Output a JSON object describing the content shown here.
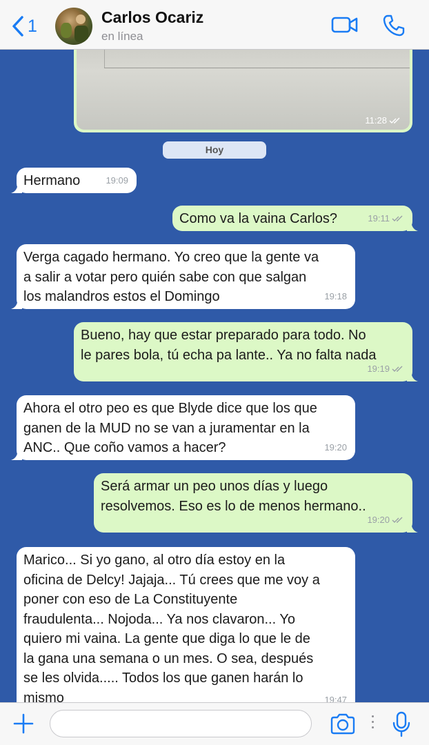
{
  "header": {
    "back_count": "1",
    "contact_name": "Carlos Ocariz",
    "status": "en línea",
    "back_icon": "chevron-left-icon",
    "video_icon": "video-call-icon",
    "phone_icon": "phone-icon"
  },
  "chat": {
    "image_message": {
      "time": "11:28"
    },
    "date_separator": "Hoy",
    "messages": [
      {
        "direction": "in",
        "text": "Hermano",
        "time": "19:09"
      },
      {
        "direction": "out",
        "text": "Como va la vaina Carlos?",
        "time": "19:11"
      },
      {
        "direction": "in",
        "text": "Verga cagado hermano. Yo creo que la gente va\na salir a votar pero quién sabe con que salgan\nlos malandros estos el Domingo",
        "time": "19:18"
      },
      {
        "direction": "out",
        "text": "Bueno, hay que estar preparado para todo. No\nle pares bola, tú echa pa lante.. Ya no falta nada",
        "time": "19:19"
      },
      {
        "direction": "in",
        "text": "Ahora el otro peo es que Blyde dice que los que\nganen de la MUD no se van a juramentar en la\nANC.. Que coño vamos a hacer?",
        "time": "19:20"
      },
      {
        "direction": "out",
        "text": "Será armar un peo unos días y luego\nresolvemos. Eso es lo de menos hermano..",
        "time": "19:20"
      },
      {
        "direction": "in",
        "text": "Marico... Si yo gano, al otro día estoy en la\noficina de Delcy! Jajaja... Tú crees que me voy a\nponer con eso de La Constituyente\nfraudulenta... Nojoda... Ya nos clavaron... Yo\nquiero mi vaina. La gente que diga lo que le de\nla gana una semana o un mes. O sea, después\nse les olvida..... Todos los que ganen harán lo\nmismo",
        "time": "19:47"
      }
    ]
  },
  "composer": {
    "placeholder": "",
    "plus_icon": "plus-icon",
    "camera_icon": "camera-icon",
    "mic_icon": "microphone-icon"
  },
  "colors": {
    "accent": "#1a7cf4",
    "chat_background": "#2f5aa8",
    "outgoing_bubble": "#dcf8c6",
    "incoming_bubble": "#ffffff"
  }
}
